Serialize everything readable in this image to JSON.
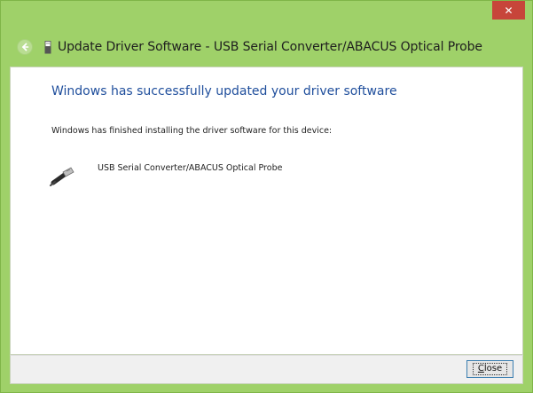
{
  "window": {
    "title": "Update Driver Software - USB Serial Converter/ABACUS Optical Probe",
    "close_glyph": "✕",
    "frame_color": "#9fd169",
    "close_color": "#c7453a"
  },
  "nav": {
    "back_icon": "back-arrow-icon",
    "title_icon": "usb-device-icon"
  },
  "main": {
    "heading": "Windows has successfully updated your driver software",
    "heading_color": "#1f4e9c",
    "message": "Windows has finished installing the driver software for this device:",
    "device": {
      "icon": "usb-plug-icon",
      "name": "USB Serial Converter/ABACUS Optical Probe"
    }
  },
  "footer": {
    "close_label_first": "C",
    "close_label_rest": "lose"
  }
}
